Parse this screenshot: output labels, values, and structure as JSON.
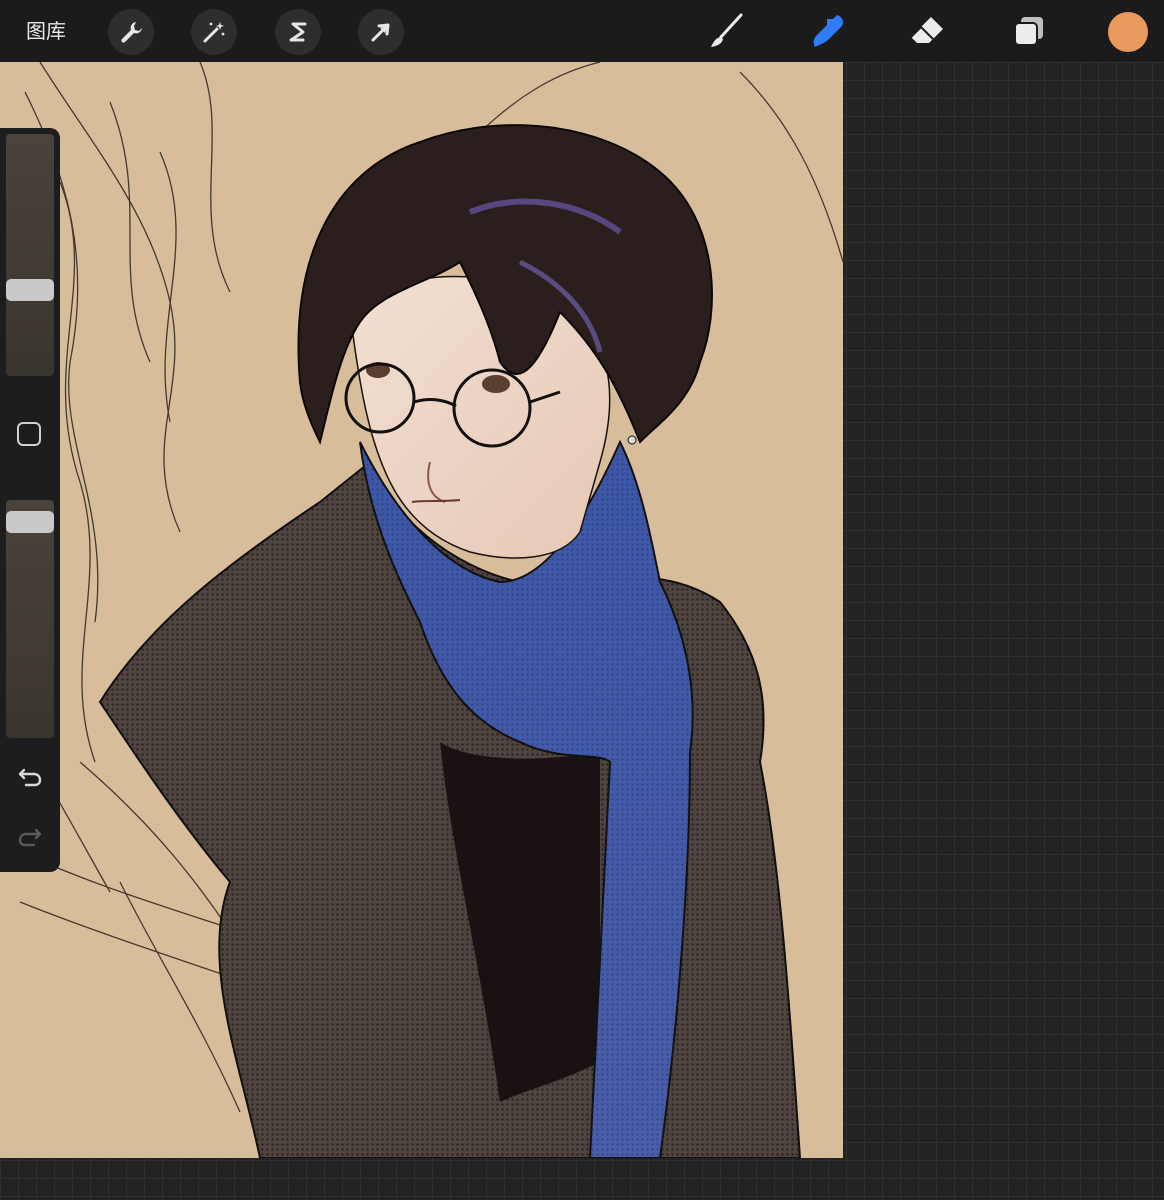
{
  "topbar": {
    "gallery_label": "图库",
    "actions": [
      {
        "name": "actions-wrench"
      },
      {
        "name": "adjustments-magic-wand"
      },
      {
        "name": "selection-s"
      },
      {
        "name": "transform-arrow"
      }
    ],
    "tools": [
      {
        "name": "brush",
        "icon": "brush-icon",
        "active": false
      },
      {
        "name": "smudge",
        "icon": "smudge-icon",
        "active": true
      },
      {
        "name": "eraser",
        "icon": "eraser-icon",
        "active": false
      },
      {
        "name": "layers",
        "icon": "layers-icon",
        "active": false
      }
    ],
    "current_color": "#e9995e",
    "accent_color": "#2f7cf6"
  },
  "sidebar": {
    "brush_size_level": 0.34,
    "opacity_level": 0.95,
    "undo_enabled": true,
    "redo_enabled": false
  },
  "canvas": {
    "background_color": "#d8bd9b",
    "subject": "illustration"
  }
}
